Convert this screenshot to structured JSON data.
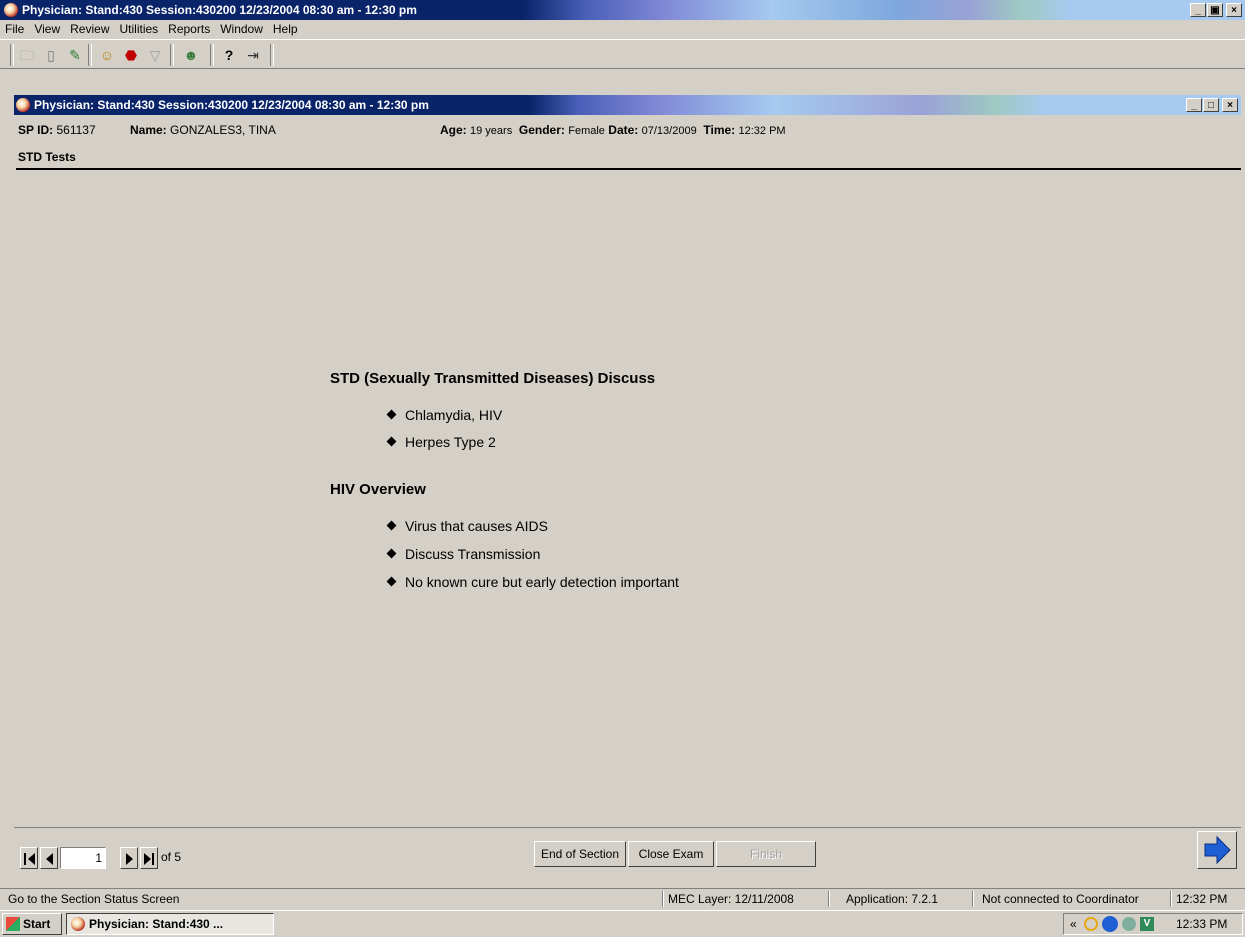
{
  "main_window": {
    "title": "Physician: Stand:430 Session:430200 12/23/2004 08:30 am - 12:30 pm"
  },
  "menu": [
    "File",
    "View",
    "Review",
    "Utilities",
    "Reports",
    "Window",
    "Help"
  ],
  "toolbar_icons": [
    "open-folder-icon",
    "document-icon",
    "edit-icon",
    "people-icon",
    "stop-icon",
    "filter-icon",
    "user-check-icon",
    "help-icon",
    "exit-icon"
  ],
  "child_window": {
    "title": "Physician: Stand:430 Session:430200 12/23/2004 08:30 am - 12:30 pm"
  },
  "patient": {
    "sp_id_label": "SP ID:",
    "sp_id": "561137",
    "name_label": "Name:",
    "name": "GONZALES3, TINA",
    "age_label": "Age:",
    "age": "19 years",
    "gender_label": "Gender:",
    "gender": "Female",
    "date_label": "Date:",
    "date": "07/13/2009",
    "time_label": "Time:",
    "time": "12:32 PM"
  },
  "section": {
    "title": "STD Tests"
  },
  "content": {
    "heading1": "STD (Sexually Transmitted Diseases) Discuss",
    "bullets1": [
      "Chlamydia, HIV",
      "Herpes Type 2"
    ],
    "heading2": "HIV Overview",
    "bullets2": [
      "Virus that causes AIDS",
      "Discuss Transmission",
      "No known cure but early detection important"
    ]
  },
  "navigation": {
    "page": "1",
    "of_label": "of 5",
    "end_section_label": "End of Section",
    "close_exam_label": "Close Exam",
    "finish_label": "Finish"
  },
  "status": {
    "hint": "Go to the Section Status Screen",
    "mec_layer": "MEC Layer: 12/11/2008",
    "application": "Application: 7.2.1",
    "connection": "Not connected to Coordinator",
    "time": "12:32 PM"
  },
  "taskbar": {
    "start_label": "Start",
    "task_label": "Physician: Stand:430 ...",
    "tray_chevron": "«",
    "clock": "12:33 PM"
  },
  "colors": {
    "title_active": "#0a246a",
    "title_gradient_end": "#a6caf0",
    "face": "#d4d0c8",
    "arrow_blue": "#1e5fd6"
  }
}
